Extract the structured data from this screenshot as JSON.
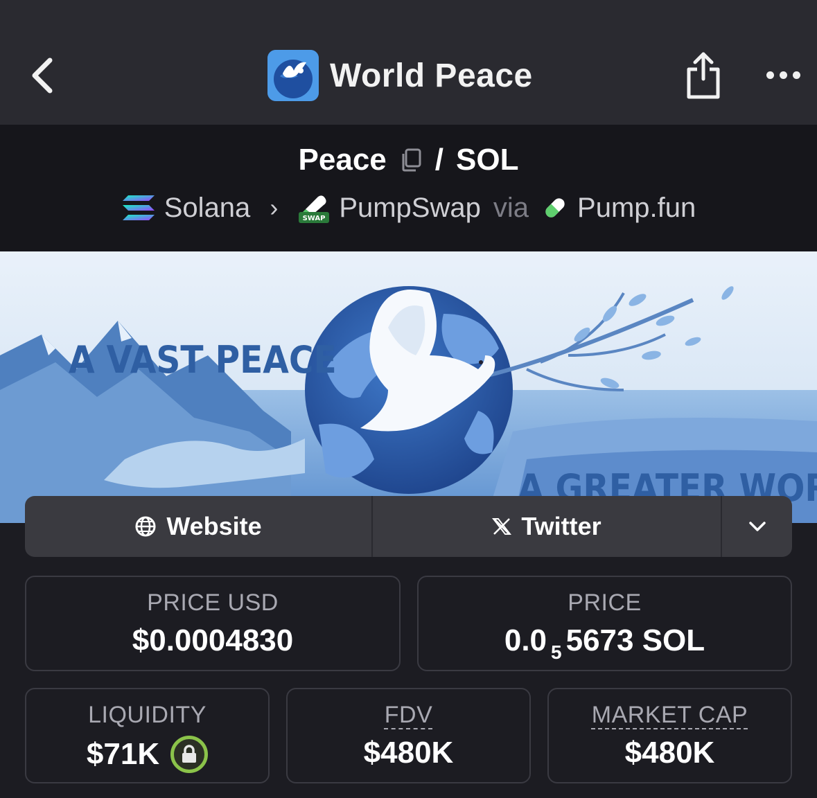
{
  "header": {
    "title": "World Peace",
    "back_icon": "chevron-left-icon",
    "share_icon": "share-icon",
    "more_icon": "more-horizontal-icon"
  },
  "pair": {
    "base": "Peace",
    "separator": "/",
    "quote": "SOL",
    "chain": "Solana",
    "dex": "PumpSwap",
    "dex_badge": "SWAP",
    "via": "via",
    "launchpad": "Pump.fun"
  },
  "banner": {
    "text_left": "A VAST PEACE",
    "text_right": "A GREATER WORLD"
  },
  "links": {
    "website": "Website",
    "twitter": "Twitter"
  },
  "stats": {
    "price_usd_label": "PRICE USD",
    "price_usd_value": "$0.0004830",
    "price_label": "PRICE",
    "price_prefix": "0.0",
    "price_zeros": "5",
    "price_suffix": "5673 SOL",
    "liquidity_label": "LIQUIDITY",
    "liquidity_value": "$71K",
    "fdv_label": "FDV",
    "fdv_value": "$480K",
    "mcap_label": "MARKET CAP",
    "mcap_value": "$480K"
  },
  "colors": {
    "background": "#1c1c22",
    "topbar": "#2a2a30",
    "pairbar": "#16161b",
    "lock_accent": "#8bc34a"
  }
}
